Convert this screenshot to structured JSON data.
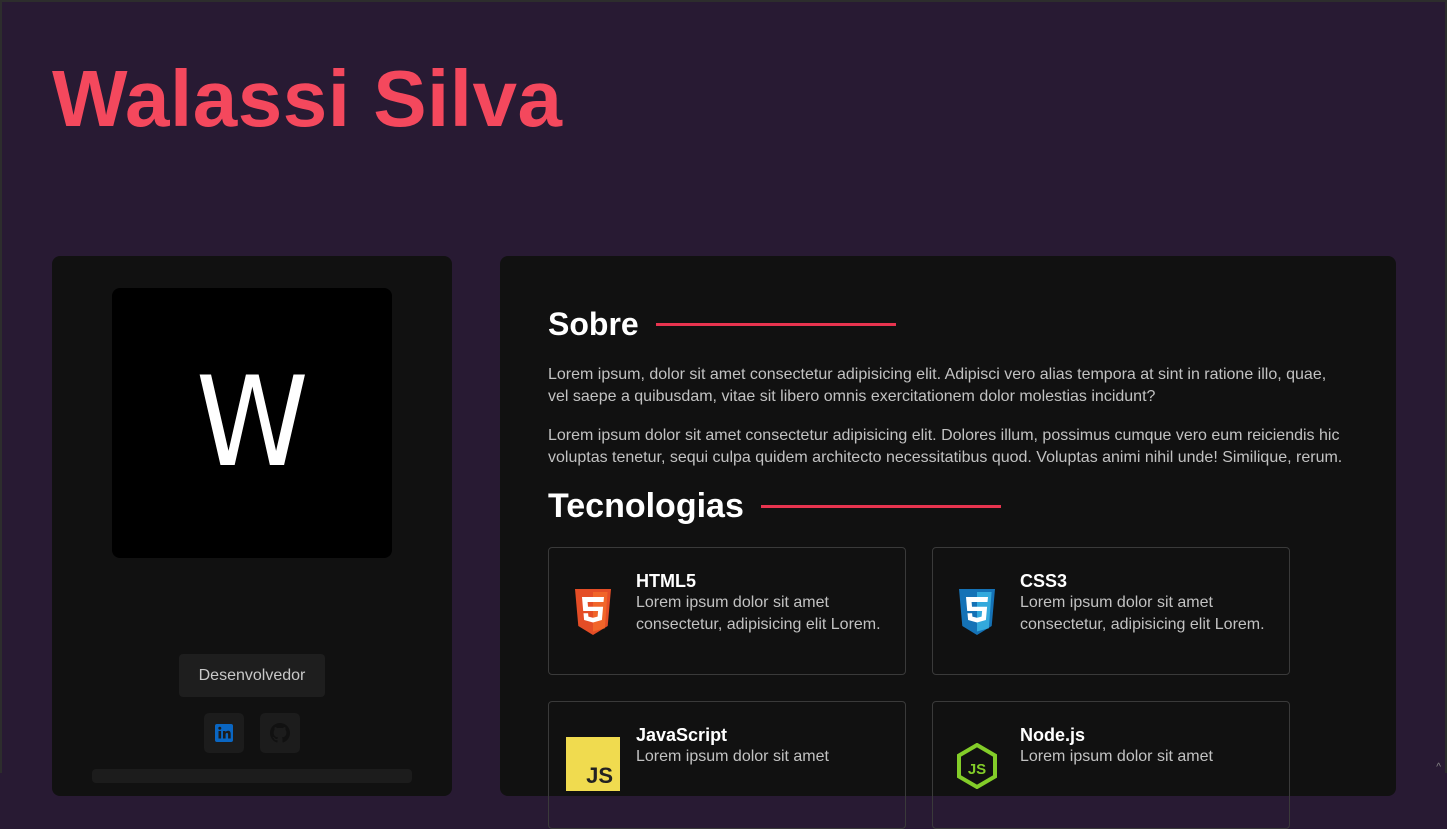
{
  "header": {
    "name": "Walassi Silva"
  },
  "profile": {
    "avatar_letter": "W",
    "role": "Desenvolvedor",
    "social": [
      {
        "icon": "linkedin-icon",
        "color": "#0a66c2"
      },
      {
        "icon": "github-icon",
        "color": "#1a1a1a"
      }
    ]
  },
  "about": {
    "title": "Sobre",
    "paragraphs": [
      "Lorem ipsum, dolor sit amet consectetur adipisicing elit. Adipisci vero alias tempora at sint in ratione illo, quae, vel saepe a quibusdam, vitae sit libero omnis exercitationem dolor molestias incidunt?",
      "Lorem ipsum dolor sit amet consectetur adipisicing elit. Dolores illum, possimus cumque vero eum reiciendis hic voluptas tenetur, sequi culpa quidem architecto necessitatibus quod. Voluptas animi nihil unde! Similique, rerum."
    ]
  },
  "technologies": {
    "title": "Tecnologias",
    "items": [
      {
        "name": "HTML5",
        "description": "Lorem ipsum dolor sit amet consectetur, adipisicing elit Lorem.",
        "icon": "html5-icon",
        "color": "#e44d26"
      },
      {
        "name": "CSS3",
        "description": "Lorem ipsum dolor sit amet consectetur, adipisicing elit Lorem.",
        "icon": "css3-icon",
        "color": "#1572b6"
      },
      {
        "name": "JavaScript",
        "description": "Lorem ipsum dolor sit amet",
        "icon": "javascript-icon",
        "color": "#f0db4f"
      },
      {
        "name": "Node.js",
        "description": "Lorem ipsum dolor sit amet",
        "icon": "nodejs-icon",
        "color": "#83cd29"
      }
    ]
  },
  "colors": {
    "background": "#281a33",
    "card": "#111111",
    "accent": "#f4485d"
  }
}
